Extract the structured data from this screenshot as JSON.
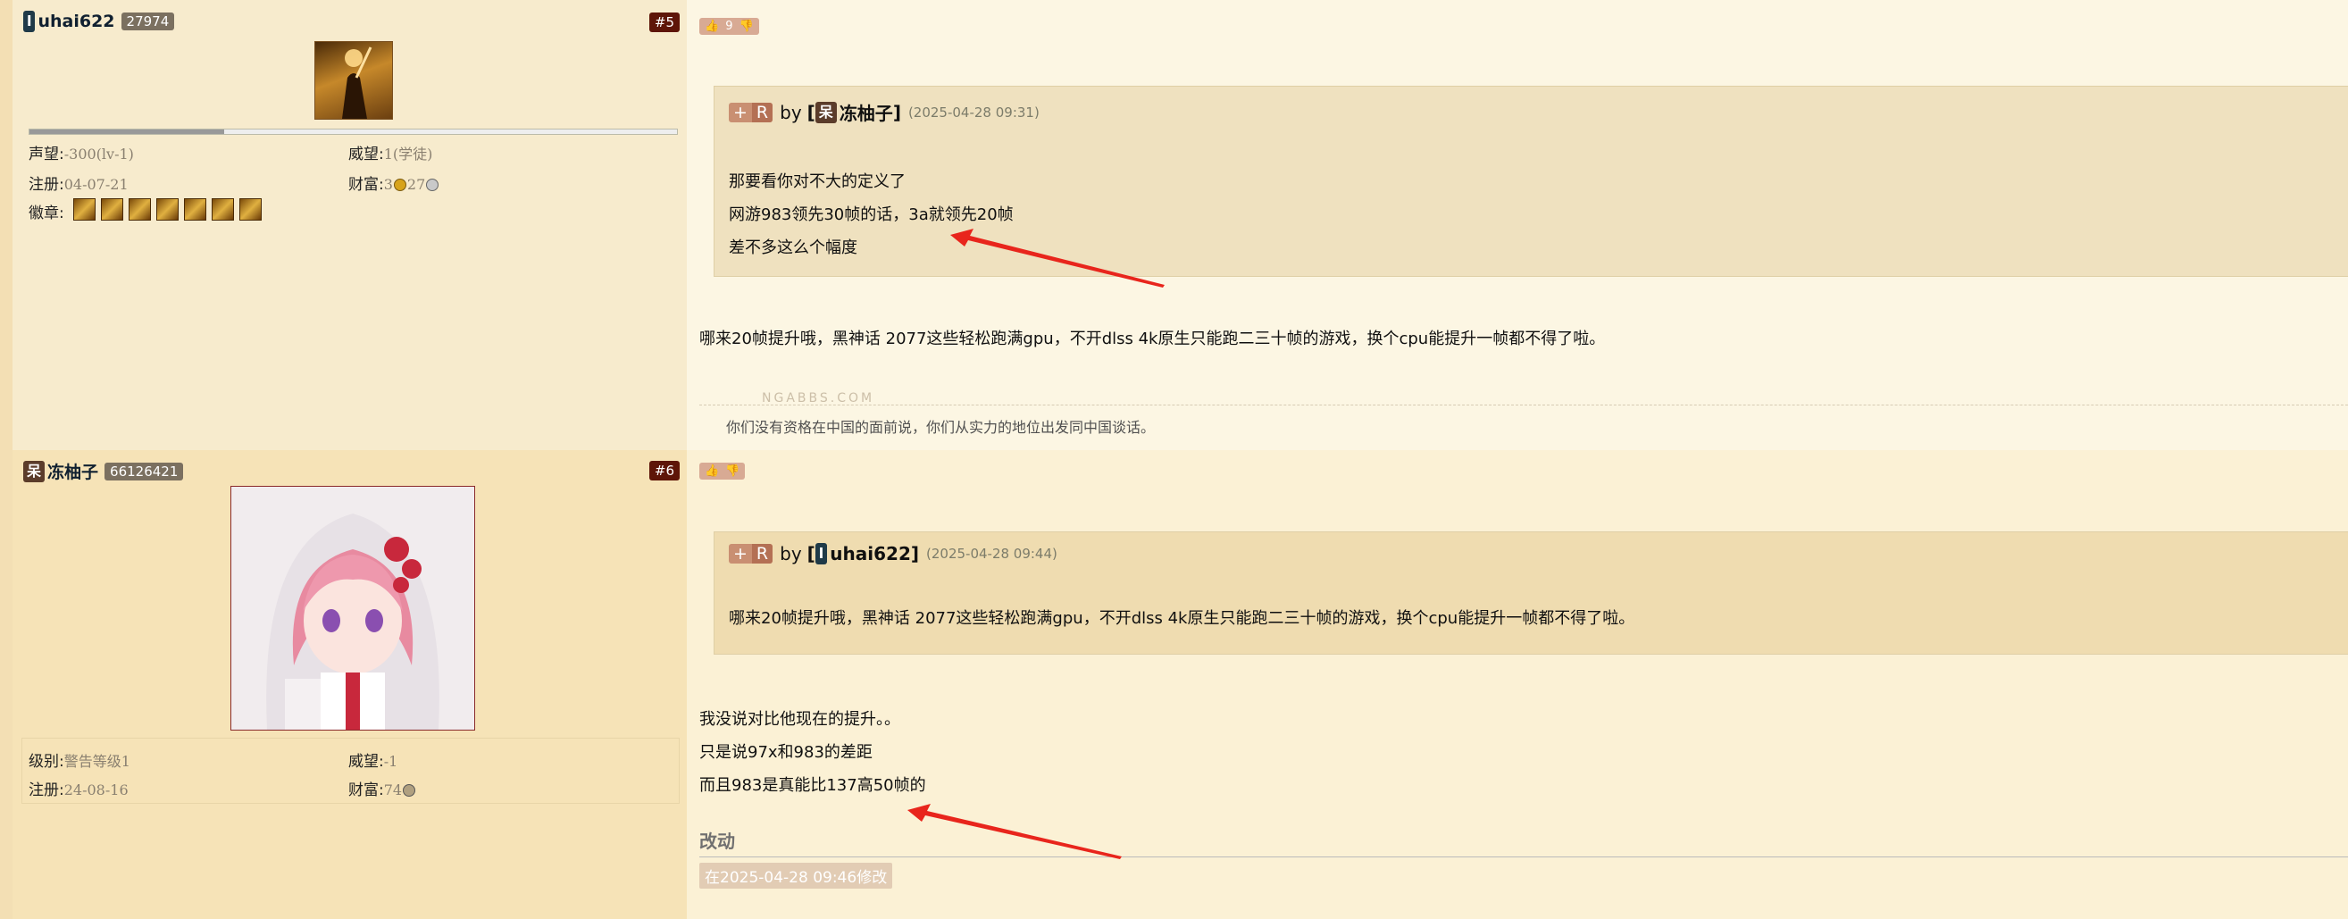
{
  "posts": [
    {
      "number": "#5",
      "user": {
        "badge": "l",
        "name": "uhai622",
        "uid": "27974"
      },
      "stats": {
        "prestige_label": "声望:",
        "prestige_value": "-300(lv-1)",
        "authority_label": "威望:",
        "authority_value": "1(学徒)",
        "reg_label": "注册:",
        "reg_value": "04-07-21",
        "wealth_label": "财富:",
        "wealth_value_a": "3",
        "wealth_value_b": "27",
        "medals_label": "徽章:"
      },
      "rep_progress": 0.3,
      "medal_count": 7,
      "vote": {
        "count": "9"
      },
      "quote": {
        "plus": "+",
        "r": "R",
        "by": "by",
        "open": "[",
        "author_badge": "呆",
        "author": "冻柚子",
        "close": "]",
        "date": "(2025-04-28 09:31)",
        "lines": [
          "那要看你对不大的定义了",
          "网游983领先30帧的话，3a就领先20帧",
          "差不多这么个幅度"
        ]
      },
      "body": [
        "哪来20帧提升哦，黑神话 2077这些轻松跑满gpu，不开dlss 4k原生只能跑二三十帧的游戏，换个cpu能提升一帧都不得了啦。"
      ],
      "watermark": "NGABBS.COM",
      "signature": "你们没有资格在中国的面前说，你们从实力的地位出发同中国谈话。"
    },
    {
      "number": "#6",
      "user": {
        "badge": "呆",
        "name": "冻柚子",
        "uid": "66126421"
      },
      "stats": {
        "level_label": "级别:",
        "level_value": "警告等级1",
        "authority_label": "威望:",
        "authority_value": "-1",
        "reg_label": "注册:",
        "reg_value": "24-08-16",
        "wealth_label": "财富:",
        "wealth_value": "74"
      },
      "vote": {},
      "quote": {
        "plus": "+",
        "r": "R",
        "by": "by",
        "open": "[",
        "author_badge": "l",
        "author": "uhai622",
        "close": "]",
        "date": "(2025-04-28 09:44)",
        "lines": [
          "哪来20帧提升哦，黑神话 2077这些轻松跑满gpu，不开dlss 4k原生只能跑二三十帧的游戏，换个cpu能提升一帧都不得了啦。"
        ]
      },
      "body": [
        "我没说对比他现在的提升。。",
        "只是说97x和983的差距",
        "而且983是真能比137高50帧的"
      ],
      "changed_label": "改动",
      "edit_note": "在2025-04-28 09:46修改"
    }
  ],
  "colors": {
    "arrow": "#e8251c",
    "post_number_bg": "#5e1508",
    "accent": "#c98f72"
  },
  "icons": [
    "thumb-up-icon",
    "thumb-down-icon",
    "gold-coin-icon",
    "silver-coin-icon",
    "copper-coin-icon",
    "medal-icon",
    "red-arrow-annotation"
  ]
}
